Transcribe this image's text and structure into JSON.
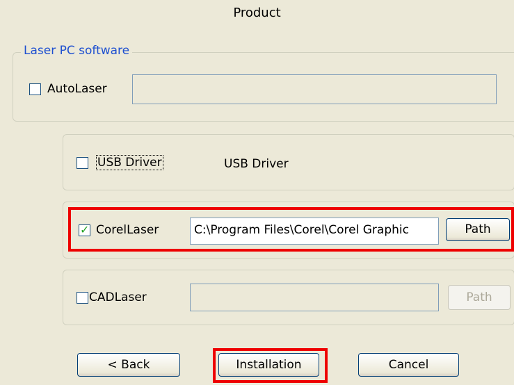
{
  "dialog": {
    "title": "Product"
  },
  "group": {
    "legend": "Laser PC software"
  },
  "autolaser": {
    "label": "AutoLaser",
    "checked": false,
    "path": ""
  },
  "usb_driver": {
    "label": "USB Driver",
    "checked": false,
    "description": "USB Driver"
  },
  "corellaser": {
    "label": "CorelLaser",
    "checked": true,
    "path": "C:\\Program Files\\Corel\\Corel Graphic",
    "path_button": "Path"
  },
  "cadlaser": {
    "label": "CADLaser",
    "checked": false,
    "path": "",
    "path_button": "Path"
  },
  "buttons": {
    "back": "< Back",
    "install": "Installation",
    "cancel": "Cancel"
  },
  "highlight_color": "#ee0000"
}
